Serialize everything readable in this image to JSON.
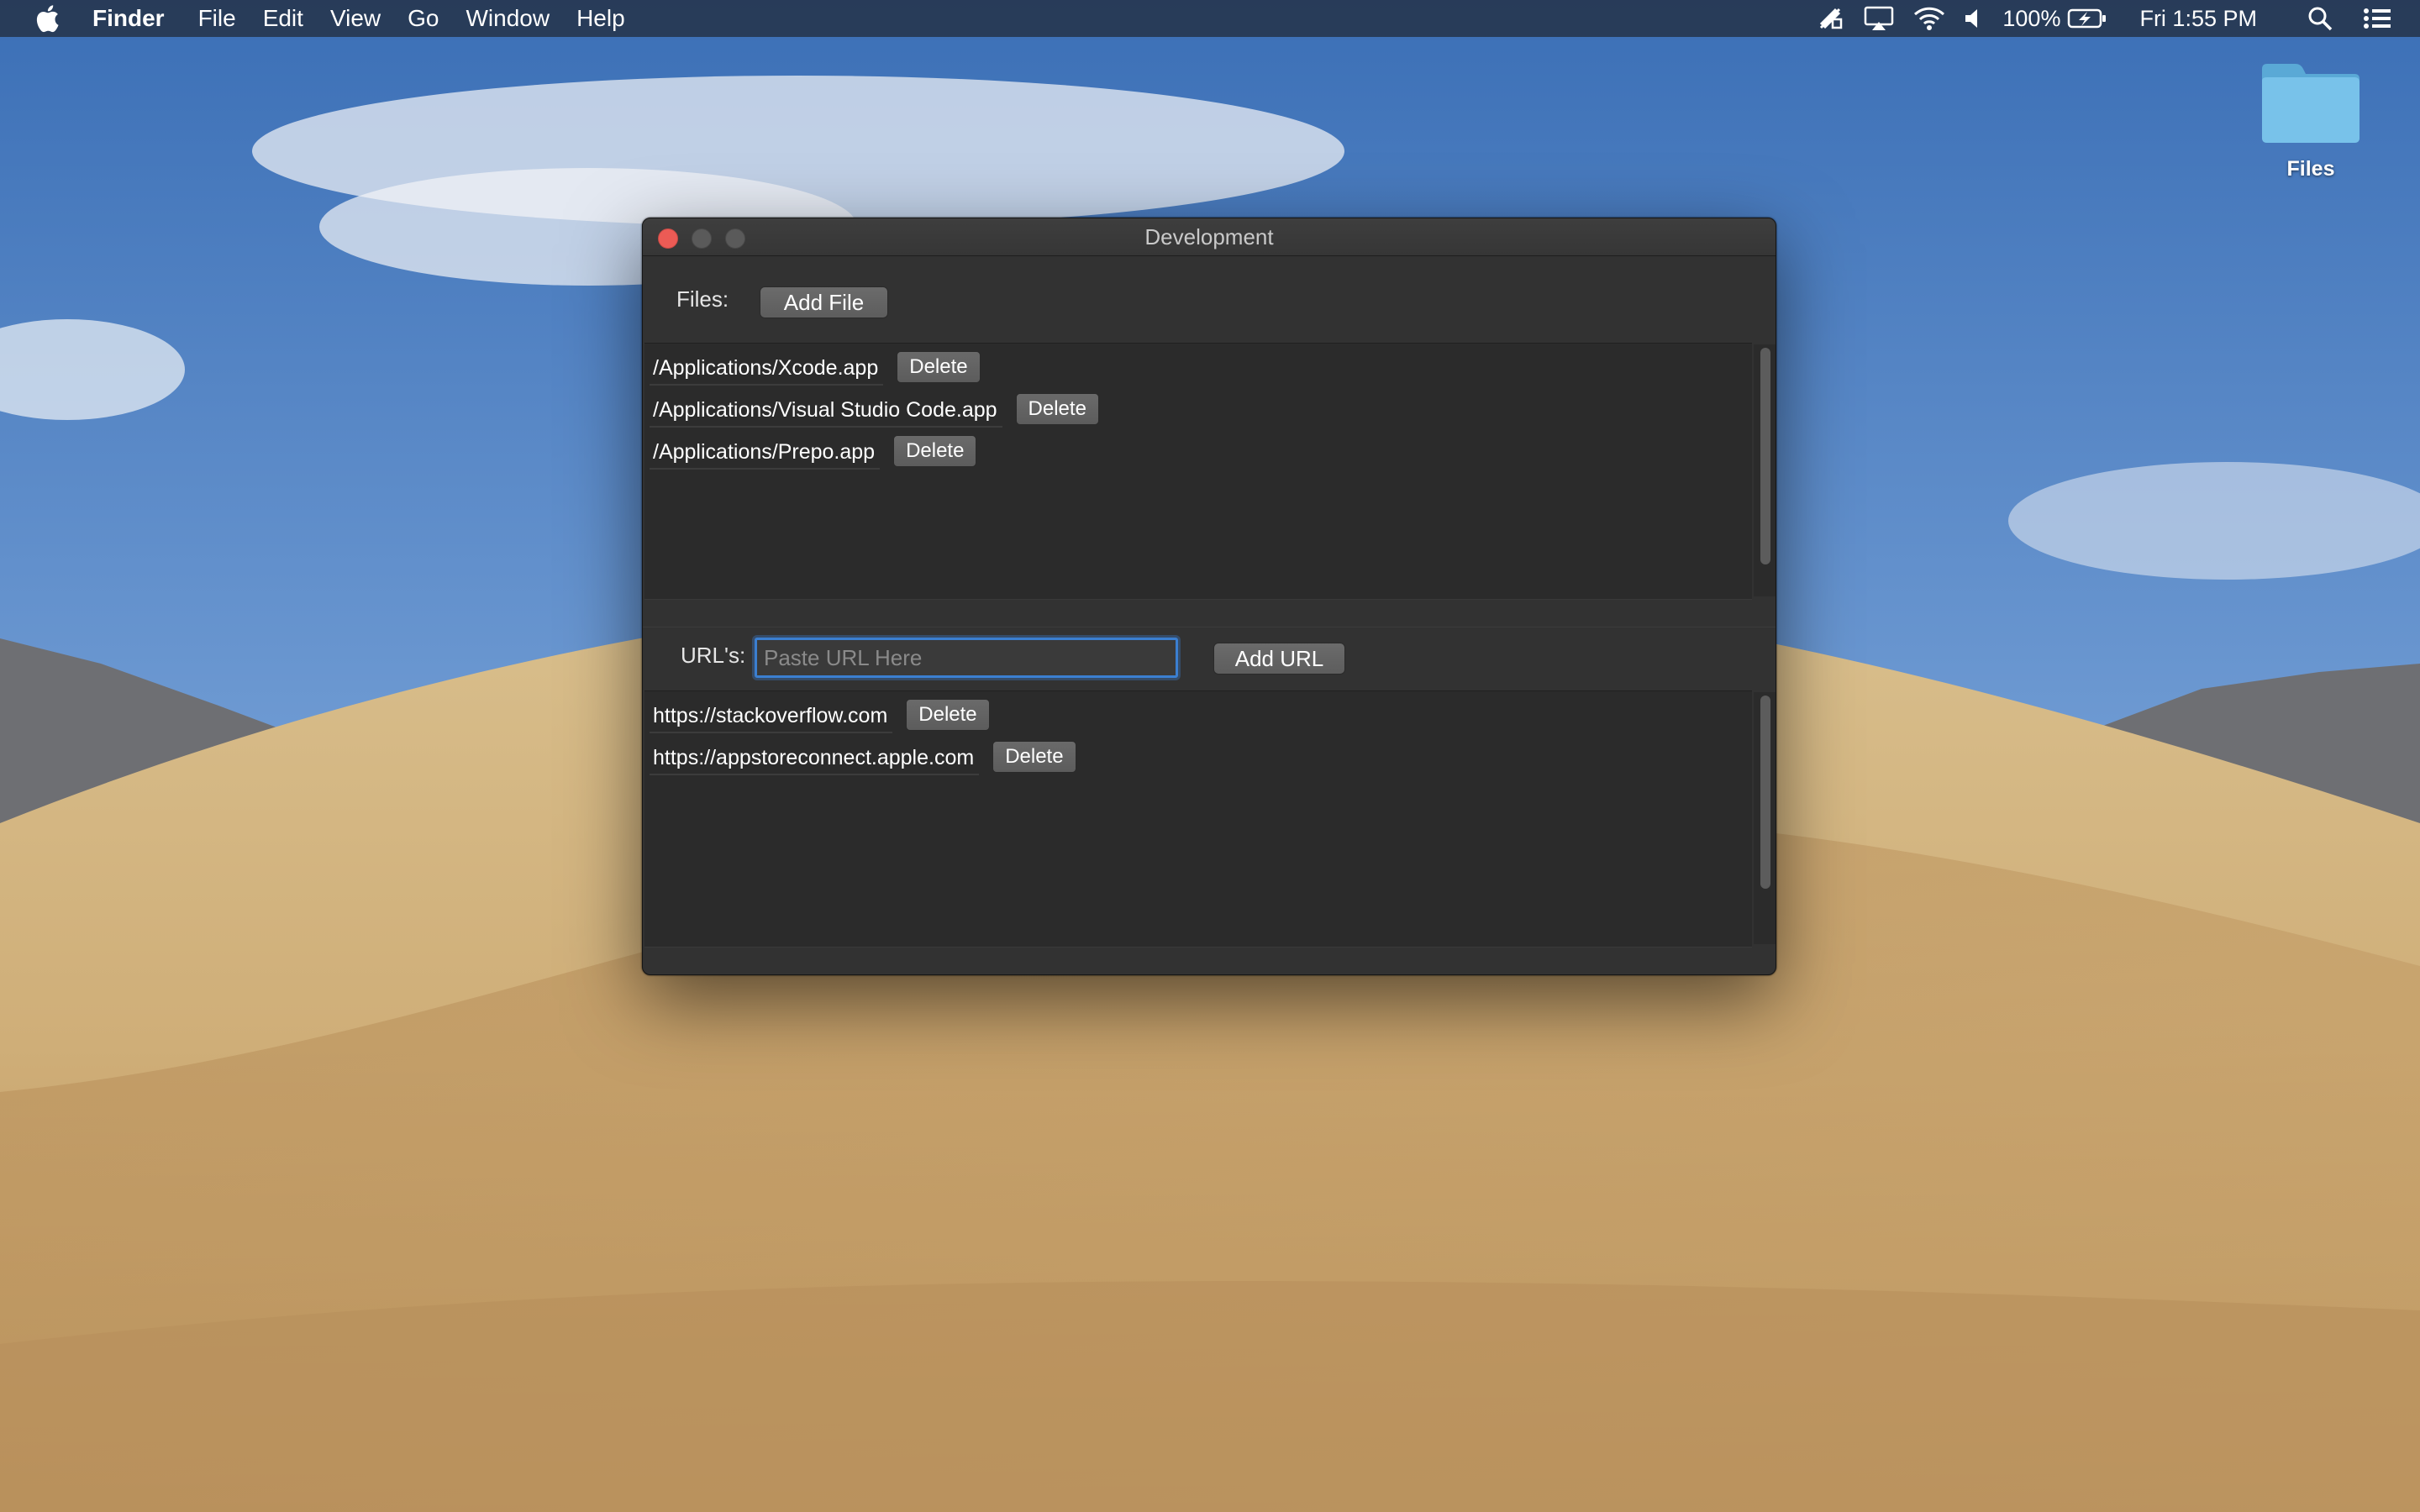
{
  "menubar": {
    "app_name": "Finder",
    "items": [
      "File",
      "Edit",
      "View",
      "Go",
      "Window",
      "Help"
    ],
    "battery": "100%",
    "clock": "Fri 1:55 PM"
  },
  "desktop": {
    "folder_label": "Files"
  },
  "window": {
    "title": "Development",
    "files": {
      "label": "Files:",
      "add_button": "Add File",
      "items": [
        {
          "path": "/Applications/Xcode.app",
          "delete": "Delete"
        },
        {
          "path": "/Applications/Visual Studio Code.app",
          "delete": "Delete"
        },
        {
          "path": "/Applications/Prepo.app",
          "delete": "Delete"
        }
      ]
    },
    "urls": {
      "label": "URL's:",
      "input_value": "",
      "input_placeholder": "Paste URL Here",
      "add_button": "Add URL",
      "items": [
        {
          "url": "https://stackoverflow.com",
          "delete": "Delete"
        },
        {
          "url": "https://appstoreconnect.apple.com",
          "delete": "Delete"
        }
      ]
    }
  },
  "colors": {
    "menubar_bg": "#26344c",
    "window_bg": "#323232",
    "list_bg": "#2b2b2b",
    "close_button": "#ec5b55",
    "focus_ring": "#3b7fd1"
  }
}
